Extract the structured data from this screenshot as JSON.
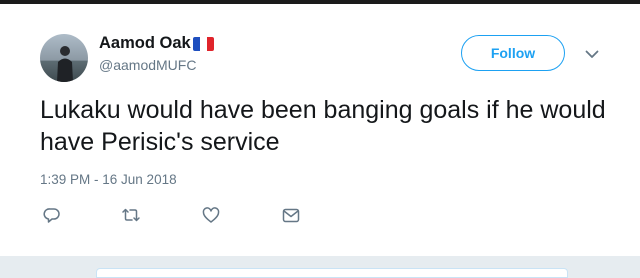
{
  "tweet": {
    "display_name": "Aamod Oak",
    "flag_icon": "france-flag-icon",
    "handle": "@aamodMUFC",
    "text": "Lukaku would have been banging goals if he would have Perisic's service",
    "timestamp": "1:39 PM - 16 Jun 2018"
  },
  "follow_button": {
    "label": "Follow"
  },
  "menu": {
    "icon": "chevron-down-icon"
  },
  "actions": [
    {
      "name": "reply",
      "icon": "reply-icon"
    },
    {
      "name": "retweet",
      "icon": "retweet-icon"
    },
    {
      "name": "like",
      "icon": "heart-icon"
    },
    {
      "name": "message",
      "icon": "envelope-icon"
    }
  ],
  "colors": {
    "accent": "#1da1f2",
    "text_primary": "#14171a",
    "text_secondary": "#657786",
    "icon_gray": "#657786",
    "background": "#e6ecf0"
  }
}
